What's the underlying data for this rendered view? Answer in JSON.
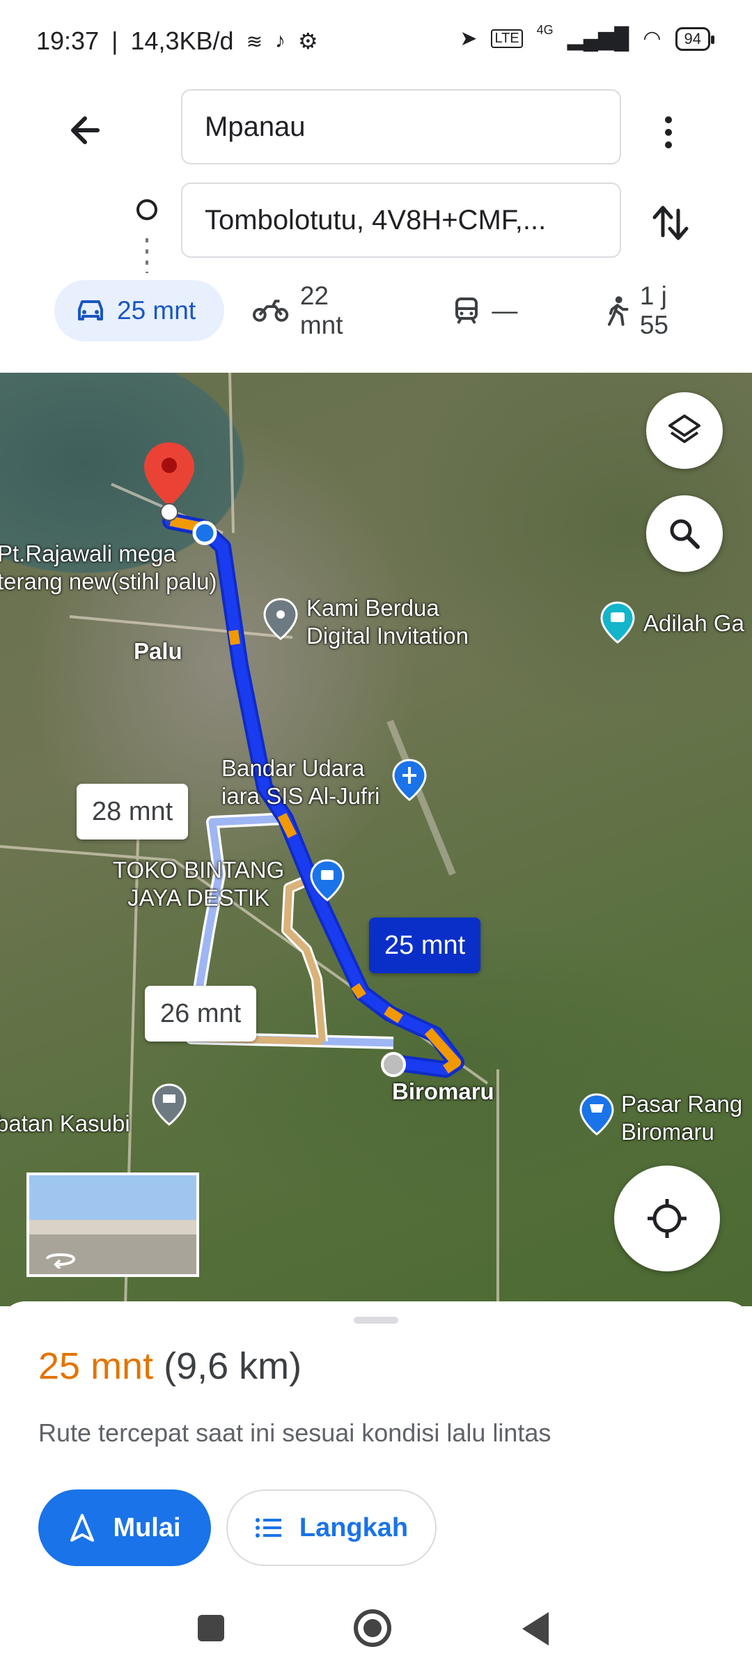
{
  "status": {
    "time": "19:37",
    "data_rate": "14,3KB/d",
    "network": "4G",
    "battery": "94"
  },
  "directions": {
    "origin": "Mpanau",
    "destination": "Tombolotutu, 4V8H+CMF,..."
  },
  "modes": [
    {
      "icon": "car-icon",
      "label": "25 mnt",
      "active": true
    },
    {
      "icon": "motorcycle-icon",
      "label": "22 mnt",
      "active": false
    },
    {
      "icon": "transit-icon",
      "label": "—",
      "active": false
    },
    {
      "icon": "walk-icon",
      "label": "1 j 55",
      "active": false
    }
  ],
  "map": {
    "labels": {
      "rajawali": "Pt.Rajawali mega\nterang new(stihl palu)",
      "palu": "Palu",
      "kami_berdua": "Kami Berdua\nDigital Invitation",
      "adilah": "Adilah Ga",
      "bandar_udara": "Bandar Udara\niara SIS Al-Jufri",
      "toko_bintang": "TOKO BINTANG\nJAYA DESTIK",
      "biromaru": "Biromaru",
      "pasar": "Pasar Rang\nBiromaru",
      "kasubi": "batan Kasubi"
    },
    "route_bubbles": {
      "alt1": "28 mnt",
      "alt2": "26 mnt",
      "main": "25 mnt"
    }
  },
  "sheet": {
    "time": "25 mnt",
    "distance": "(9,6 km)",
    "note": "Rute tercepat saat ini sesuai kondisi lalu lintas",
    "start_label": "Mulai",
    "steps_label": "Langkah"
  },
  "colors": {
    "accent": "#1a73e8",
    "route_main": "#1a3cf0",
    "route_traffic": "#f29900",
    "route_alt": "#a8bdf5",
    "time_orange": "#e37400"
  }
}
